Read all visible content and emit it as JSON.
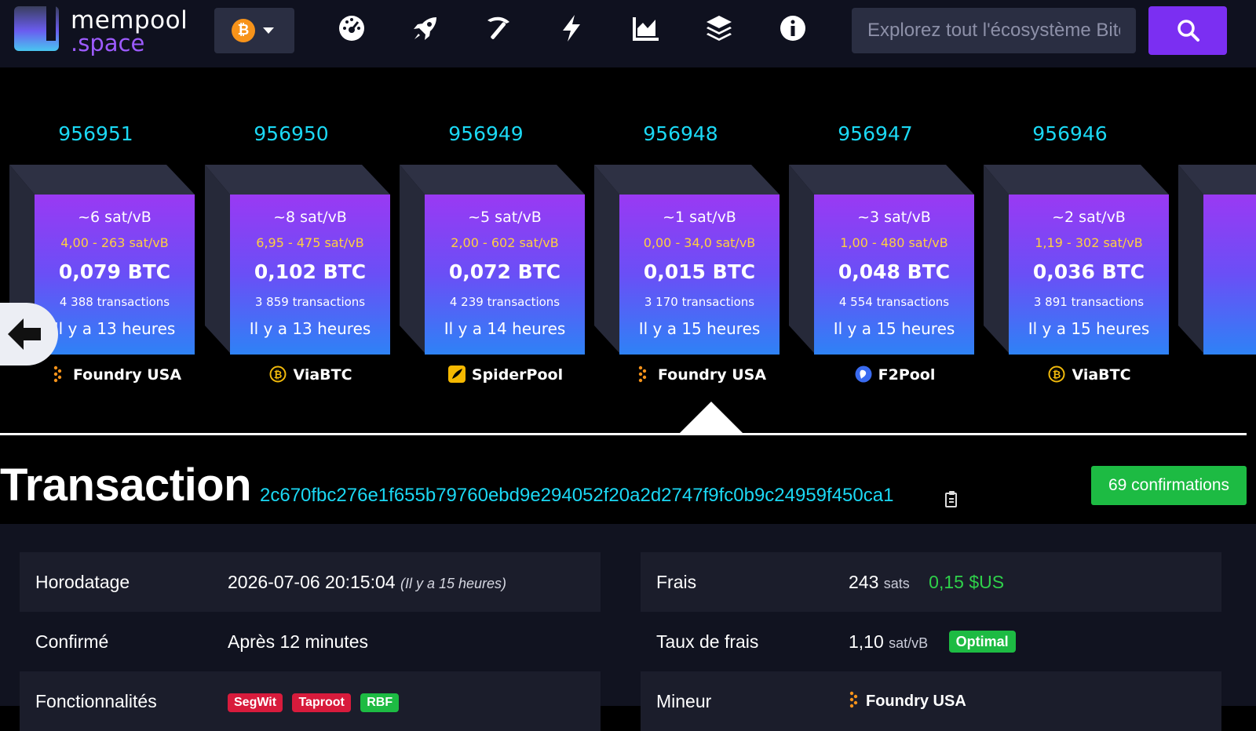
{
  "header": {
    "logo_line1": "mempool",
    "logo_line2": ".space",
    "network_symbol": "₿",
    "nav_icons": [
      "dashboard-icon",
      "rocket-icon",
      "mining-icon",
      "lightning-icon",
      "graphs-icon",
      "layers-icon",
      "info-icon"
    ],
    "search_placeholder": "Explorez tout l'écosystème Bitcoin",
    "search_icon": "search-icon"
  },
  "blocks": [
    {
      "height": "956951",
      "median_fee": "~6 sat/vB",
      "fee_range": "4,00 - 263 sat/vB",
      "total_fees": "0,079 BTC",
      "tx_count": "4 388 transactions",
      "time": "Il y a 13 heures",
      "pool": "Foundry USA",
      "pool_icon": "foundry-icon"
    },
    {
      "height": "956950",
      "median_fee": "~8 sat/vB",
      "fee_range": "6,95 - 475 sat/vB",
      "total_fees": "0,102 BTC",
      "tx_count": "3 859 transactions",
      "time": "Il y a 13 heures",
      "pool": "ViaBTC",
      "pool_icon": "viabtc-icon"
    },
    {
      "height": "956949",
      "median_fee": "~5 sat/vB",
      "fee_range": "2,00 - 602 sat/vB",
      "total_fees": "0,072 BTC",
      "tx_count": "4 239 transactions",
      "time": "Il y a 14 heures",
      "pool": "SpiderPool",
      "pool_icon": "spiderpool-icon"
    },
    {
      "height": "956948",
      "median_fee": "~1 sat/vB",
      "fee_range": "0,00 - 34,0 sat/vB",
      "total_fees": "0,015 BTC",
      "tx_count": "3 170 transactions",
      "time": "Il y a 15 heures",
      "pool": "Foundry USA",
      "pool_icon": "foundry-icon"
    },
    {
      "height": "956947",
      "median_fee": "~3 sat/vB",
      "fee_range": "1,00 - 480 sat/vB",
      "total_fees": "0,048 BTC",
      "tx_count": "4 554 transactions",
      "time": "Il y a 15 heures",
      "pool": "F2Pool",
      "pool_icon": "f2pool-icon"
    },
    {
      "height": "956946",
      "median_fee": "~2 sat/vB",
      "fee_range": "1,19 - 302 sat/vB",
      "total_fees": "0,036 BTC",
      "tx_count": "3 891 transactions",
      "time": "Il y a 15 heures",
      "pool": "ViaBTC",
      "pool_icon": "viabtc-icon"
    }
  ],
  "transaction": {
    "title": "Transaction",
    "txid": "2c670fbc276e1f655b79760ebd9e294052f20a2d2747f9fc0b9c24959f450ca1",
    "confirmations": "69 confirmations"
  },
  "details_left": {
    "timestamp_label": "Horodatage",
    "timestamp_value": "2026-07-06 20:15:04",
    "timestamp_relative": "(Il y a 15 heures)",
    "confirmed_label": "Confirmé",
    "confirmed_value": "Après 12 minutes",
    "features_label": "Fonctionnalités",
    "features": [
      {
        "label": "SegWit",
        "color": "#d81b3c"
      },
      {
        "label": "Taproot",
        "color": "#d81b3c"
      },
      {
        "label": "RBF",
        "color": "#1dbb43"
      }
    ]
  },
  "details_right": {
    "fee_label": "Frais",
    "fee_sats": "243",
    "fee_sats_unit": "sats",
    "fee_usd": "0,15 $US",
    "fee_rate_label": "Taux de frais",
    "fee_rate_value": "1,10",
    "fee_rate_unit": "sat/vB",
    "fee_rate_badge": "Optimal",
    "miner_label": "Mineur",
    "miner_value": "Foundry USA"
  },
  "colors": {
    "accent_purple": "#7b2ff2",
    "link_cyan": "#1bd8f4",
    "success_green": "#1dbb43",
    "fee_range_yellow": "#ffd040"
  }
}
